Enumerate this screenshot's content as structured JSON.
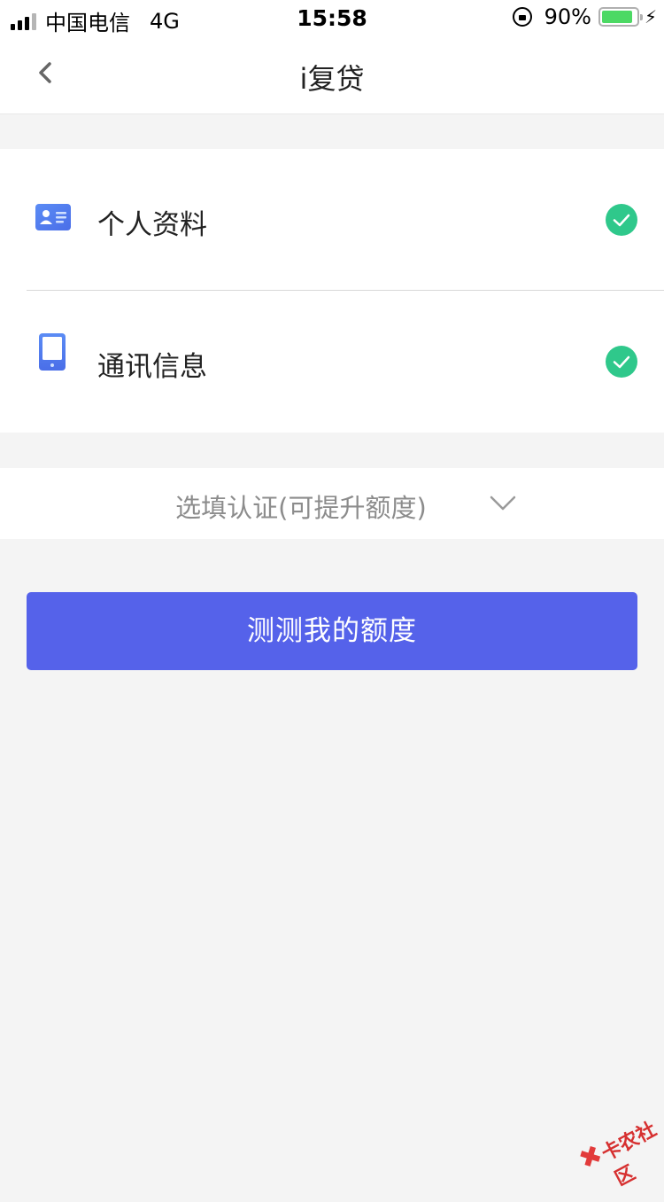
{
  "status_bar": {
    "carrier": "中国电信",
    "network": "4G",
    "time": "15:58",
    "battery_percent": "90%",
    "battery_level": 0.9
  },
  "nav": {
    "title": "i复贷",
    "back_icon": "chevron-left-icon"
  },
  "items": [
    {
      "label": "个人资料",
      "icon": "id-card-icon",
      "status": "completed",
      "status_icon": "check-circle-icon"
    },
    {
      "label": "通讯信息",
      "icon": "phone-icon",
      "status": "completed",
      "status_icon": "check-circle-icon"
    }
  ],
  "optional": {
    "label": "选填认证(可提升额度)",
    "icon": "chevron-down-icon"
  },
  "primary_button": {
    "label": "测测我的额度"
  },
  "watermark": {
    "text": "卡农社区"
  },
  "colors": {
    "primary": "#5562ea",
    "check": "#2fc88b",
    "icon_blue": "#4f7df0",
    "background": "#f4f4f4"
  }
}
